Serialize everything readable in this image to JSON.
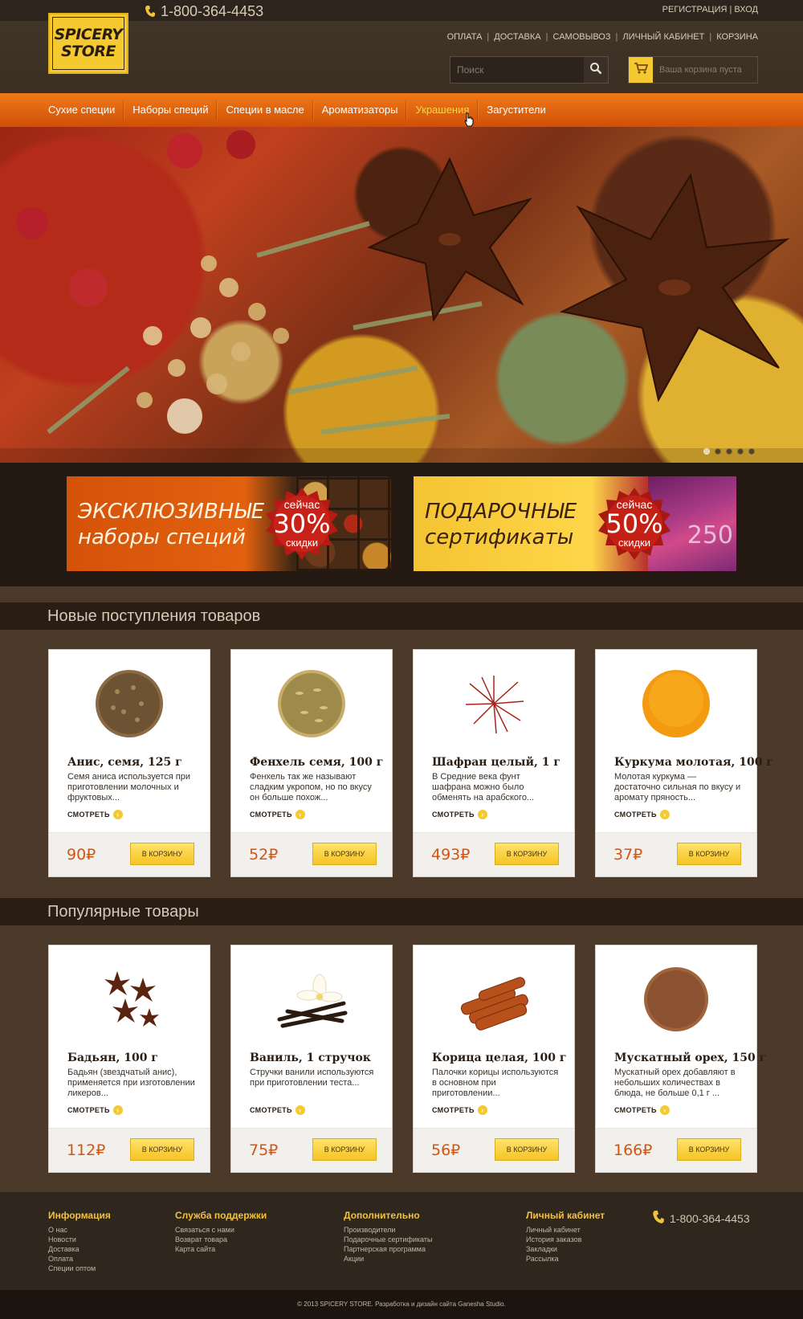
{
  "header": {
    "logo_line1": "SPICERY",
    "logo_line2": "STORE",
    "phone": "1-800-364-4453",
    "auth": {
      "register": "РЕГИСТРАЦИЯ",
      "separator": "|",
      "login": "ВХОД"
    },
    "top_menu": [
      "ОПЛАТА",
      "ДОСТАВКА",
      "САМОВЫВОЗ",
      "ЛИЧНЫЙ КАБИНЕТ",
      "КОРЗИНА"
    ],
    "search_placeholder": "Поиск",
    "cart_text": "Ваша корзина пуста"
  },
  "nav": {
    "items": [
      {
        "label": "Сухие специи"
      },
      {
        "label": "Наборы специй"
      },
      {
        "label": "Специи в масле"
      },
      {
        "label": "Ароматизаторы"
      },
      {
        "label": "Украшения"
      },
      {
        "label": "Загустители"
      }
    ],
    "active_index": 4
  },
  "hero": {
    "slide_count": 5,
    "active_slide": 0
  },
  "promos": [
    {
      "title_line1": "ЭКСКЛЮЗИВНЫЕ",
      "title_line2": "наборы специй",
      "seal_top": "сейчас",
      "seal_value": "30%",
      "seal_bottom": "скидки"
    },
    {
      "title_line1": "ПОДАРОЧНЫЕ",
      "title_line2": "сертификаты",
      "seal_top": "сейчас",
      "seal_value": "50%",
      "seal_bottom": "скидки",
      "cert_number": "250"
    }
  ],
  "new_section": {
    "title": "Новые поступления товаров",
    "products": [
      {
        "name": "Анис, семя, 125 г",
        "desc": "Семя аниса используется при приготовлении молочных и фруктовых...",
        "more": "СМОТРЕТЬ",
        "price": "90₽",
        "buy": "В КОРЗИНУ"
      },
      {
        "name": "Фенхель семя, 100 г",
        "desc": "Фенхель так же называют сладким укропом, но по вкусу он больше похож...",
        "more": "СМОТРЕТЬ",
        "price": "52₽",
        "buy": "В КОРЗИНУ"
      },
      {
        "name": "Шафран целый, 1 г",
        "desc": "В Средние века фунт шафрана можно было обменять на арабского...",
        "more": "СМОТРЕТЬ",
        "price": "493₽",
        "buy": "В КОРЗИНУ"
      },
      {
        "name": "Куркума молотая, 100 г",
        "desc": "Молотая куркума — достаточно сильная по вкусу и аромату пряность...",
        "more": "СМОТРЕТЬ",
        "price": "37₽",
        "buy": "В КОРЗИНУ"
      }
    ]
  },
  "popular_section": {
    "title": "Популярные товары",
    "products": [
      {
        "name": "Бадьян, 100 г",
        "desc": "Бадьян (звездчатый анис), применяется при изготовлении ликеров...",
        "more": "СМОТРЕТЬ",
        "price": "112₽",
        "buy": "В КОРЗИНУ"
      },
      {
        "name": "Ваниль, 1 стручок",
        "desc": "Стручки ванили используются при приготовлении теста...",
        "more": "СМОТРЕТЬ",
        "price": "75₽",
        "buy": "В КОРЗИНУ"
      },
      {
        "name": "Корица целая, 100 г",
        "desc": "Палочки корицы используются в основном при приготовлении...",
        "more": "СМОТРЕТЬ",
        "price": "56₽",
        "buy": "В КОРЗИНУ"
      },
      {
        "name": "Мускатный орех, 150 г",
        "desc": "Мускатный орех добавляют в небольших количествах в блюда, не больше 0,1 г ...",
        "more": "СМОТРЕТЬ",
        "price": "166₽",
        "buy": "В КОРЗИНУ"
      }
    ]
  },
  "footer": {
    "columns": [
      {
        "title": "Информация",
        "links": [
          "О нас",
          "Новости",
          "Доставка",
          "Оплата",
          "Специи оптом"
        ]
      },
      {
        "title": "Служба поддержки",
        "links": [
          "Связаться с нами",
          "Возврат товара",
          "Карта сайта"
        ]
      },
      {
        "title": "Дополнительно",
        "links": [
          "Производители",
          "Подарочные сертификаты",
          "Партнерская программа",
          "Акции"
        ]
      },
      {
        "title": "Личный кабинет",
        "links": [
          "Личный кабинет",
          "История заказов",
          "Закладки",
          "Рассылка"
        ]
      }
    ],
    "phone": "1-800-364-4453",
    "copyright": "© 2013 SPICERY STORE.  Разработка и дизайн сайта Ganesha Studio."
  },
  "colors": {
    "accent_orange": "#e06612",
    "accent_yellow": "#f5c930",
    "price": "#d3550f",
    "dark_bg": "#2a1d14"
  }
}
